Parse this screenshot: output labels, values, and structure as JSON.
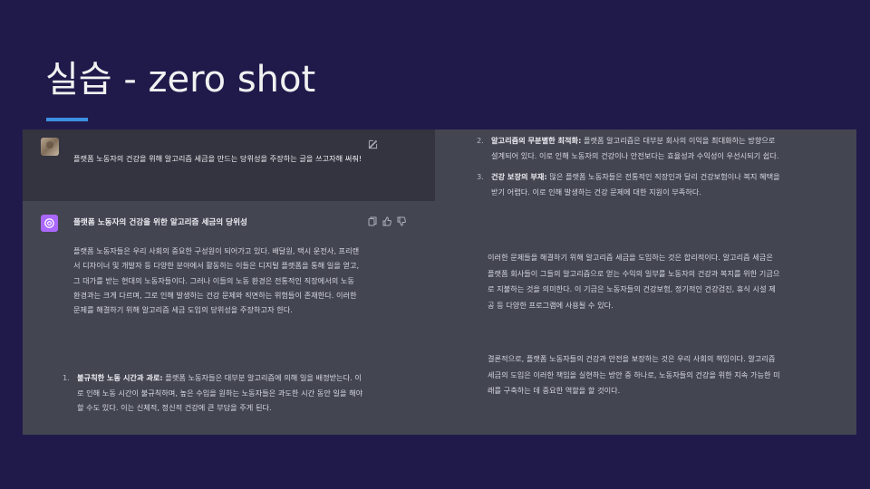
{
  "slide": {
    "title": "실습 - zero shot",
    "accent_color": "#3d8fe0",
    "background_color": "#201a4b"
  },
  "chat": {
    "user_message": "플랫폼 노동자의 건강을 위해 알고리즘 세금을 만드는 당위성을 주장하는 글을 쓰고자해 써줘!",
    "assistant_title": "플랫폼 노동자의 건강을 위한 알고리즘 세금의 당위성",
    "assistant_intro": "플랫폼 노동자들은 우리 사회의 중요한 구성원이 되어가고 있다. 배달원, 택시 운전사, 프리랜서 디자이너 및 개발자 등 다양한 분야에서 활동하는 이들은 디지털 플랫폼을 통해 일을 얻고, 그 대가를 받는 현대의 노동자들이다. 그러나 이들의 노동 환경은 전통적인 직장에서의 노동 환경과는 크게 다르며, 그로 인해 발생하는 건강 문제와 직면하는 위험들이 존재한다. 이러한 문제를 해결하기 위해 알고리즘 세금 도입의 당위성을 주장하고자 한다.",
    "points": [
      {
        "num": "1.",
        "bold": "불규칙한 노동 시간과 과로:",
        "text": " 플랫폼 노동자들은 대부분 알고리즘에 의해 일을 배정받는다. 이로 인해 노동 시간이 불규칙하며, 높은 수입을 원하는 노동자들은 과도한 시간 동안 일을 해야 할 수도 있다. 이는 신체적, 정신적 건강에 큰 부담을 주게 된다."
      },
      {
        "num": "2.",
        "bold": "알고리즘의 무분별한 최적화:",
        "text": " 플랫폼 알고리즘은 대부분 회사의 이익을 최대화하는 방향으로 설계되어 있다. 이로 인해 노동자의 건강이나 안전보다는 효율성과 수익성이 우선시되기 쉽다."
      },
      {
        "num": "3.",
        "bold": "건강 보장의 부재:",
        "text": " 많은 플랫폼 노동자들은 전통적인 직장인과 달리 건강보험이나 복지 혜택을 받기 어렵다. 이로 인해 발생하는 건강 문제에 대한 지원이 부족하다."
      }
    ],
    "paragraph_2": "이러한 문제들을 해결하기 위해 알고리즘 세금을 도입하는 것은 합리적이다. 알고리즘 세금은 플랫폼 회사들이 그들의 알고리즘으로 얻는 수익의 일부를 노동자의 건강과 복지를 위한 기금으로 지불하는 것을 의미한다. 이 기금은 노동자들의 건강보험, 정기적인 건강검진, 휴식 시설 제공 등 다양한 프로그램에 사용될 수 있다.",
    "paragraph_3": "결론적으로, 플랫폼 노동자들의 건강과 안전을 보장하는 것은 우리 사회의 책임이다. 알고리즘 세금의 도입은 이러한 책임을 실현하는 방안 중 하나로, 노동자들의 건강을 위한 지속 가능한 미래를 구축하는 데 중요한 역할을 할 것이다.",
    "icons": {
      "user": "user-avatar",
      "assistant": "chatgpt-logo-icon",
      "edit": "edit-icon",
      "copy": "copy-icon",
      "thumbs_up": "thumbs-up-icon",
      "thumbs_down": "thumbs-down-icon"
    },
    "colors": {
      "assistant_bg": "#434551",
      "user_bg": "#33343f",
      "assistant_icon": "#ab68ff"
    }
  }
}
